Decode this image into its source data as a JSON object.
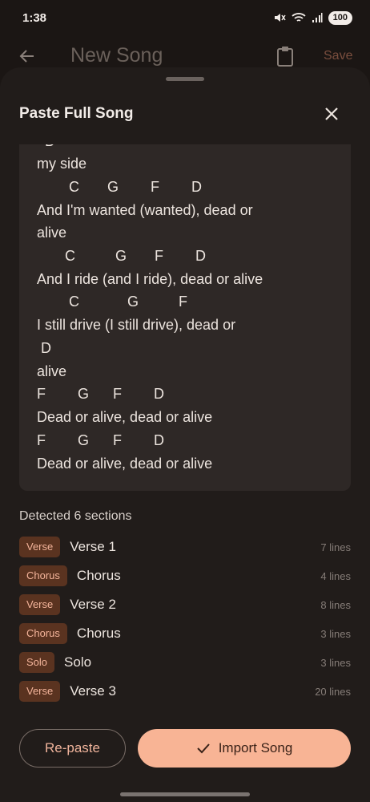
{
  "status_bar": {
    "time": "1:38",
    "battery": "100"
  },
  "app_bar": {
    "title": "New Song",
    "save_label": "Save",
    "icons": [
      "back-arrow-icon",
      "clipboard-icon"
    ]
  },
  "sheet": {
    "title": "Paste Full Song",
    "lyrics_lines": [
      "  D",
      "my side",
      "        C       G        F        D",
      "And I'm wanted (wanted), dead or",
      "alive",
      "       C          G       F        D",
      "And I ride (and I ride), dead or alive",
      "        C            G          F",
      "I still drive (I still drive), dead or",
      " D",
      "alive",
      "F        G      F        D",
      "Dead or alive, dead or alive",
      "F        G      F        D",
      "Dead or alive, dead or alive"
    ],
    "detected_label": "Detected 6 sections",
    "sections": [
      {
        "type": "Verse",
        "name": "Verse 1",
        "lines": "7 lines"
      },
      {
        "type": "Chorus",
        "name": "Chorus",
        "lines": "4 lines"
      },
      {
        "type": "Verse",
        "name": "Verse 2",
        "lines": "8 lines"
      },
      {
        "type": "Chorus",
        "name": "Chorus",
        "lines": "3 lines"
      },
      {
        "type": "Solo",
        "name": "Solo",
        "lines": "3 lines"
      },
      {
        "type": "Verse",
        "name": "Verse 3",
        "lines": "20 lines"
      }
    ],
    "repaste_label": "Re-paste",
    "import_label": "Import Song"
  },
  "colors": {
    "background": "#1b1614",
    "sheet": "#211c1a",
    "accent": "#f8b495",
    "badge_bg": "#5a3320",
    "badge_text": "#f4b49a"
  }
}
